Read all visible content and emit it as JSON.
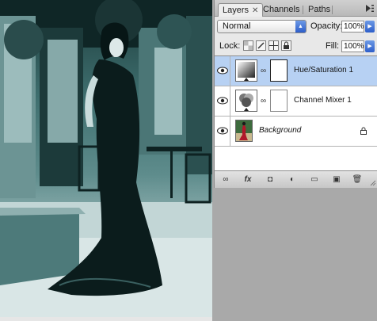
{
  "panel": {
    "tabs": [
      {
        "label": "Layers",
        "active": true,
        "closable": true
      },
      {
        "label": "Channels",
        "active": false,
        "closable": false
      },
      {
        "label": "Paths",
        "active": false,
        "closable": false
      }
    ],
    "blend_mode": "Normal",
    "opacity_label": "Opacity:",
    "opacity_value": "100%",
    "lock_label": "Lock:",
    "fill_label": "Fill:",
    "fill_value": "100%",
    "lock_icons": [
      "lock-transparent-icon",
      "lock-image-icon",
      "lock-position-icon",
      "lock-all-icon"
    ],
    "link_symbol": "∞",
    "layers": [
      {
        "name": "Hue/Saturation 1",
        "selected": true,
        "visible": true,
        "type": "adjustment",
        "has_mask": true
      },
      {
        "name": "Channel Mixer 1",
        "selected": false,
        "visible": true,
        "type": "adjustment",
        "has_mask": true
      },
      {
        "name": "Background",
        "selected": false,
        "visible": true,
        "type": "image",
        "locked": true,
        "italic": true
      }
    ],
    "footer_buttons": [
      {
        "name": "link-layers-icon",
        "glyph": "∞"
      },
      {
        "name": "layer-style-icon",
        "glyph": "fx"
      },
      {
        "name": "add-mask-icon",
        "glyph": "◘"
      },
      {
        "name": "adjustment-layer-icon",
        "glyph": "◐"
      },
      {
        "name": "new-group-icon",
        "glyph": "▭"
      },
      {
        "name": "new-layer-icon",
        "glyph": "▣"
      },
      {
        "name": "delete-layer-icon",
        "glyph": "🗑"
      }
    ]
  },
  "colors": {
    "photo_tint": "#2e5e5e",
    "selection": "#b7d1f3",
    "accent_blue": "#3a6ed8"
  }
}
